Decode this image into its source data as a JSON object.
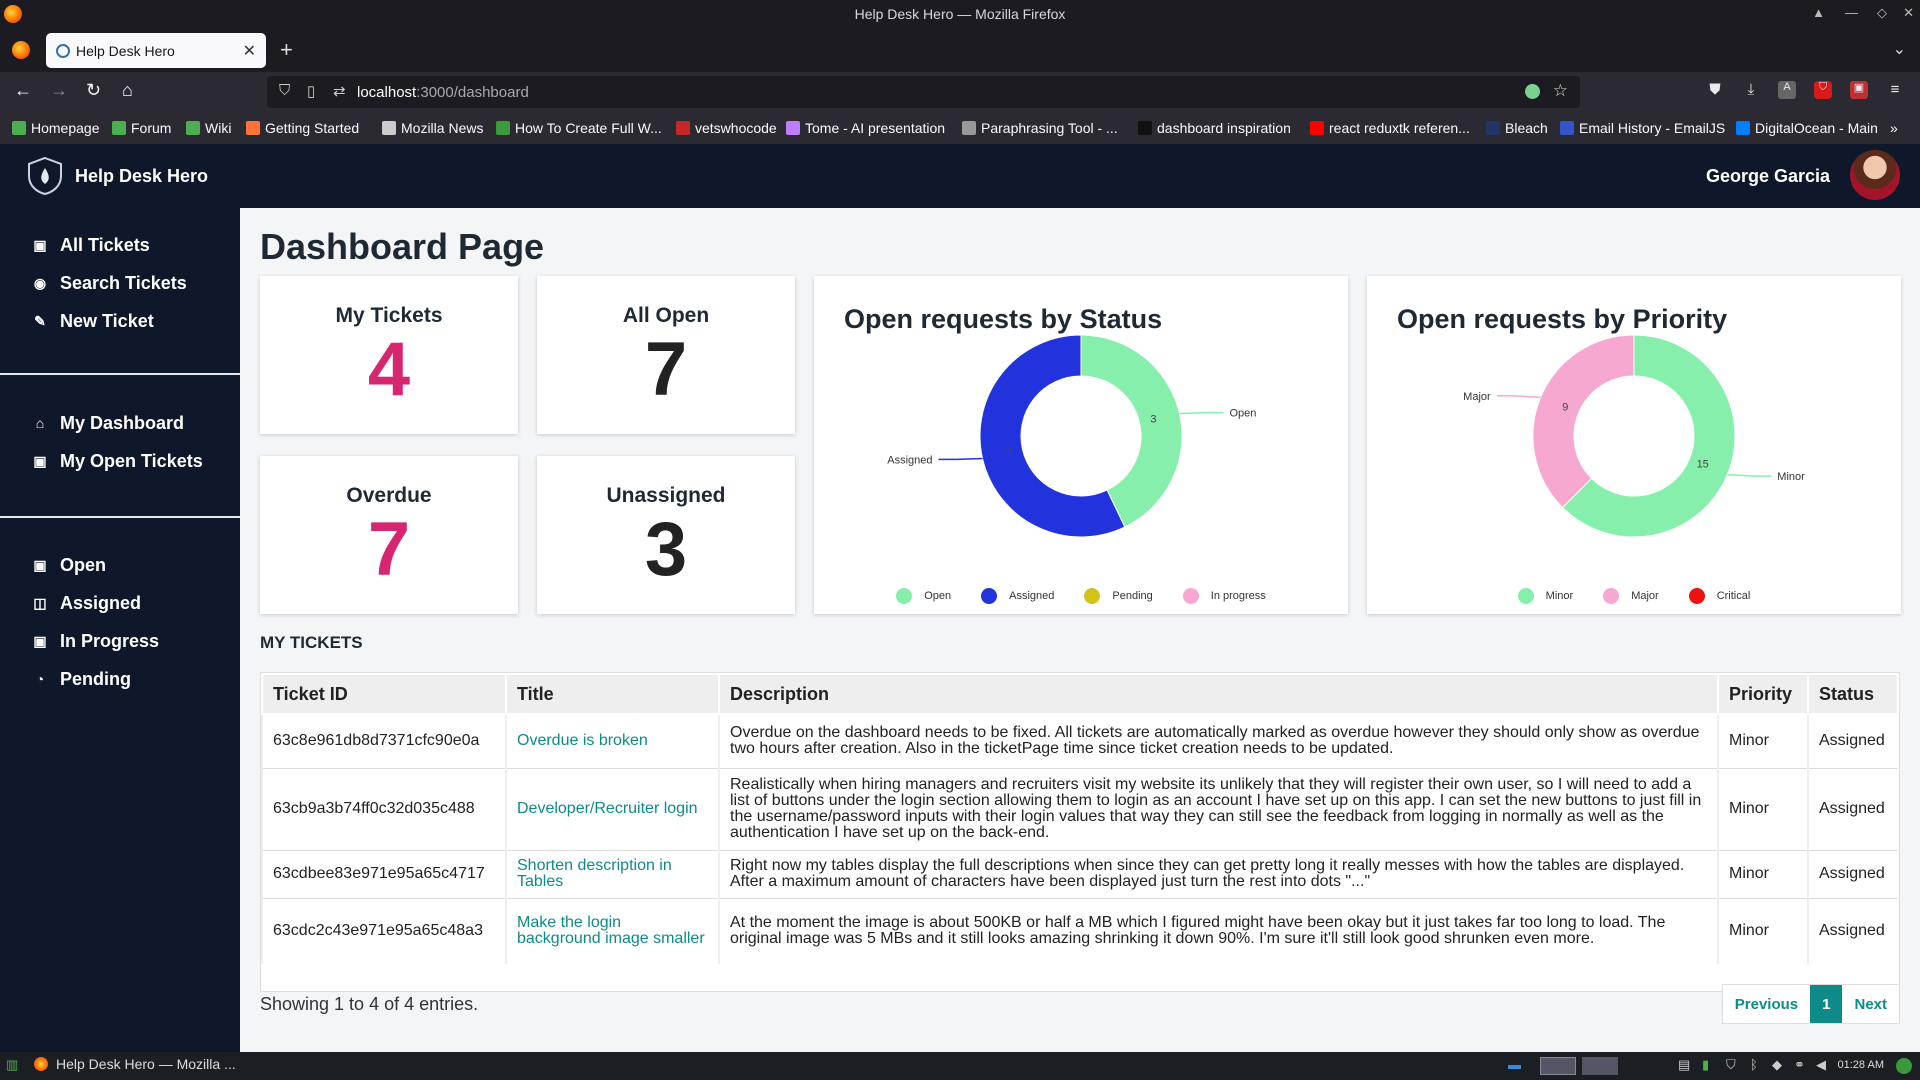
{
  "browser": {
    "window_title": "Help Desk Hero — Mozilla Firefox",
    "tab_title": "Help Desk Hero",
    "url_host": "localhost",
    "url_path": ":3000/dashboard",
    "bookmarks": [
      {
        "label": "Homepage",
        "color": "#4caf50"
      },
      {
        "label": "Forum",
        "color": "#4caf50"
      },
      {
        "label": "Wiki",
        "color": "#4caf50"
      },
      {
        "label": "Getting Started",
        "color": "#ff7139"
      },
      {
        "label": "Mozilla News",
        "color": "#cccccc"
      },
      {
        "label": "How To Create Full W...",
        "color": "#3c9a3c"
      },
      {
        "label": "vetswhocode",
        "color": "#c62828"
      },
      {
        "label": "Tome - AI presentation",
        "color": "#c07cff"
      },
      {
        "label": "Paraphrasing Tool - ...",
        "color": "#999999"
      },
      {
        "label": "dashboard inspiration",
        "color": "#111111"
      },
      {
        "label": "react reduxtk referen...",
        "color": "#ff0000"
      },
      {
        "label": "Bleach",
        "color": "#223366"
      },
      {
        "label": "Email History - EmailJS",
        "color": "#3355cc"
      },
      {
        "label": "DigitalOcean - Main",
        "color": "#0080ff"
      }
    ]
  },
  "app": {
    "brand": "Help Desk Hero",
    "user_name": "George Garcia"
  },
  "sidebar": {
    "group1": [
      {
        "label": "All Tickets",
        "icon": "ticket-icon"
      },
      {
        "label": "Search Tickets",
        "icon": "search-icon"
      },
      {
        "label": "New Ticket",
        "icon": "edit-icon"
      }
    ],
    "group2": [
      {
        "label": "My Dashboard",
        "icon": "home-icon"
      },
      {
        "label": "My Open Tickets",
        "icon": "ticket-icon"
      }
    ],
    "group3": [
      {
        "label": "Open",
        "icon": "ticket-icon"
      },
      {
        "label": "Assigned",
        "icon": "assign-icon"
      },
      {
        "label": "In Progress",
        "icon": "ticket-icon"
      },
      {
        "label": "Pending",
        "icon": "clock-icon"
      }
    ]
  },
  "page": {
    "title": "Dashboard Page",
    "stats": [
      {
        "label": "My Tickets",
        "value": "4",
        "color": "#d6266f"
      },
      {
        "label": "All Open",
        "value": "7",
        "color": "#222222"
      },
      {
        "label": "Overdue",
        "value": "7",
        "color": "#d6266f"
      },
      {
        "label": "Unassigned",
        "value": "3",
        "color": "#222222"
      }
    ],
    "section_title": "MY TICKETS",
    "table": {
      "headers": [
        "Ticket ID",
        "Title",
        "Description",
        "Priority",
        "Status"
      ],
      "rows": [
        {
          "id": "63c8e961db8d7371cfc90e0a",
          "title": "Overdue is broken",
          "description": "Overdue on the dashboard needs to be fixed. All tickets are automatically marked as overdue however they should only show as overdue two hours after creation. Also in the ticketPage time since ticket creation needs to be updated.",
          "priority": "Minor",
          "status": "Assigned"
        },
        {
          "id": "63cb9a3b74ff0c32d035c488",
          "title": "Developer/Recruiter login",
          "description": "Realistically when hiring managers and recruiters visit my website its unlikely that they will register their own user, so I will need to add a list of buttons under the login section allowing them to login as an account I have set up on this app. I can set the new buttons to just fill in the username/password inputs with their login values that way they can still see the feedback from logging in normally as well as the authentication I have set up on the back-end.",
          "priority": "Minor",
          "status": "Assigned"
        },
        {
          "id": "63cdbee83e971e95a65c4717",
          "title": "Shorten description in Tables",
          "description": "Right now my tables display the full descriptions when since they can get pretty long it really messes with how the tables are displayed. After a maximum amount of characters have been displayed just turn the rest into dots \"...\"",
          "priority": "Minor",
          "status": "Assigned"
        },
        {
          "id": "63cdc2c43e971e95a65c48a3",
          "title": "Make the login background image smaller",
          "description": "At the moment the image is about 500KB or half a MB which I figured might have been okay but it just takes far too long to load. The original image was 5 MBs and it still looks amazing shrinking it down 90%. I'm sure it'll still look good shrunken even more.",
          "priority": "Minor",
          "status": "Assigned"
        }
      ]
    },
    "showing": "Showing 1 to 4 of 4 entries.",
    "pager": {
      "prev": "Previous",
      "current": "1",
      "next": "Next"
    }
  },
  "chart_data": [
    {
      "type": "pie",
      "title": "Open requests by Status",
      "categories": [
        "Open",
        "Assigned",
        "Pending",
        "In progress"
      ],
      "values": [
        3,
        4,
        0,
        0
      ],
      "colors": [
        "#86efac",
        "#2233dd",
        "#d4c21a",
        "#f7a8d0"
      ],
      "legend": "bottom"
    },
    {
      "type": "pie",
      "title": "Open requests by Priority",
      "categories": [
        "Minor",
        "Major",
        "Critical"
      ],
      "values": [
        15,
        9,
        0
      ],
      "colors": [
        "#86efac",
        "#f7a8d0",
        "#ee1111"
      ],
      "legend": "bottom"
    }
  ],
  "taskbar": {
    "app_label": "Help Desk Hero — Mozilla ...",
    "clock": "01:28 AM"
  }
}
